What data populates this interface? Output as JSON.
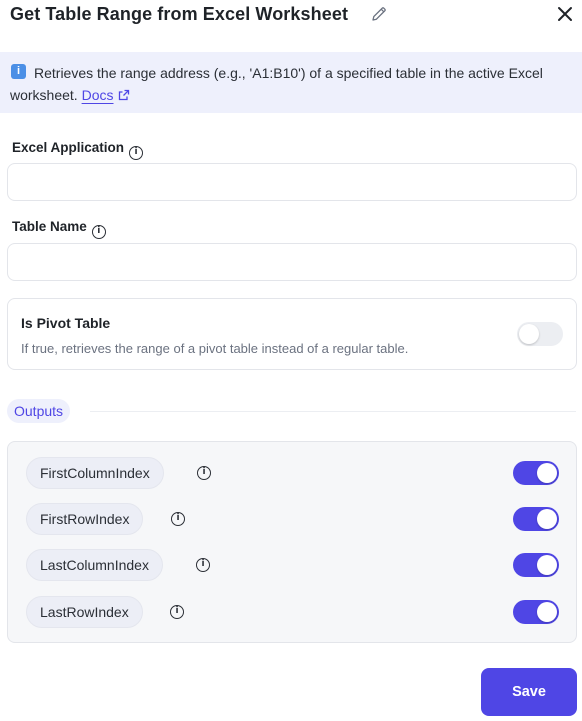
{
  "header": {
    "title": "Get Table Range from Excel Worksheet"
  },
  "info": {
    "badge": "i",
    "text": "Retrieves the range address (e.g., 'A1:B10') of a specified table in the active Excel worksheet.",
    "docs_label": "Docs"
  },
  "fields": {
    "excel_application": {
      "label": "Excel Application",
      "value": "",
      "placeholder": ""
    },
    "table_name": {
      "label": "Table Name",
      "value": "",
      "placeholder": ""
    }
  },
  "pivot": {
    "label": "Is Pivot Table",
    "description": "If true, retrieves the range of a pivot table instead of a regular table.",
    "enabled": false
  },
  "outputs": {
    "section_label": "Outputs",
    "items": [
      {
        "name": "FirstColumnIndex",
        "enabled": true
      },
      {
        "name": "FirstRowIndex",
        "enabled": true
      },
      {
        "name": "LastColumnIndex",
        "enabled": true
      },
      {
        "name": "LastRowIndex",
        "enabled": true
      }
    ]
  },
  "footer": {
    "save_label": "Save"
  },
  "colors": {
    "accent": "#4f46e5",
    "banner_bg": "#eef0fc",
    "info_badge": "#4b8fe6"
  },
  "icons": [
    "pencil-icon",
    "close-icon",
    "info-icon",
    "external-link-icon",
    "info-circle-icon"
  ]
}
